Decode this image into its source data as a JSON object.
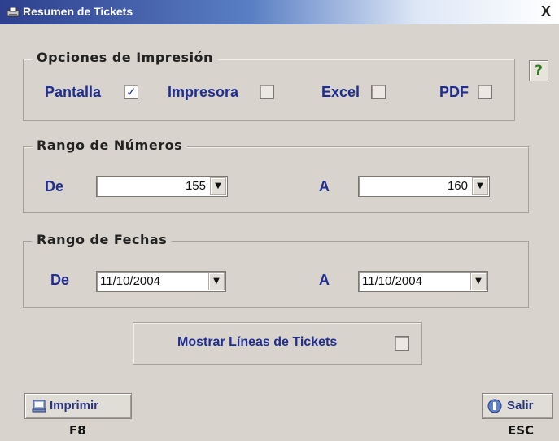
{
  "window": {
    "title": "Resumen de Tickets",
    "close_label": "X"
  },
  "help": {
    "label": "?"
  },
  "print_options": {
    "legend": "Opciones de Impresión",
    "items": [
      {
        "label": "Pantalla",
        "checked": true
      },
      {
        "label": "Impresora",
        "checked": false
      },
      {
        "label": "Excel",
        "checked": false
      },
      {
        "label": "PDF",
        "checked": false
      }
    ]
  },
  "number_range": {
    "legend": "Rango de Números",
    "from_label": "De",
    "from_value": "155",
    "to_label": "A",
    "to_value": "160"
  },
  "date_range": {
    "legend": "Rango de Fechas",
    "from_label": "De",
    "from_value": "11/10/2004",
    "to_label": "A",
    "to_value": "11/10/2004"
  },
  "show_lines": {
    "label": "Mostrar Líneas de Tickets",
    "checked": false
  },
  "buttons": {
    "print": {
      "label": "Imprimir",
      "shortcut": "F8"
    },
    "exit": {
      "label": "Salir",
      "shortcut": "ESC"
    }
  },
  "dropdown_arrow": "▼",
  "colors": {
    "label_blue": "#1f2e90",
    "title_gradient_start": "#2d3f8e",
    "background": "#d8d3cc"
  }
}
